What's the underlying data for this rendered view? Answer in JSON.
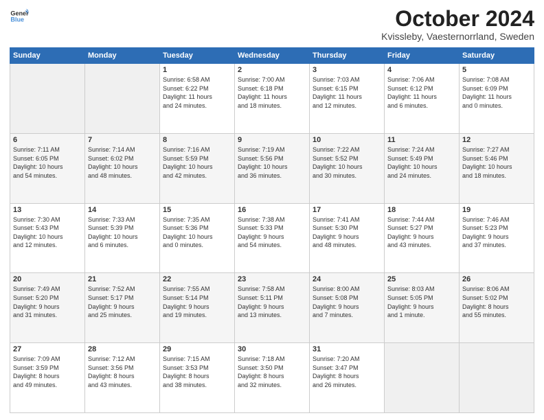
{
  "logo": {
    "line1": "General",
    "line2": "Blue"
  },
  "title": "October 2024",
  "subtitle": "Kvissleby, Vaesternorrland, Sweden",
  "weekdays": [
    "Sunday",
    "Monday",
    "Tuesday",
    "Wednesday",
    "Thursday",
    "Friday",
    "Saturday"
  ],
  "weeks": [
    [
      {
        "day": "",
        "info": ""
      },
      {
        "day": "",
        "info": ""
      },
      {
        "day": "1",
        "info": "Sunrise: 6:58 AM\nSunset: 6:22 PM\nDaylight: 11 hours\nand 24 minutes."
      },
      {
        "day": "2",
        "info": "Sunrise: 7:00 AM\nSunset: 6:18 PM\nDaylight: 11 hours\nand 18 minutes."
      },
      {
        "day": "3",
        "info": "Sunrise: 7:03 AM\nSunset: 6:15 PM\nDaylight: 11 hours\nand 12 minutes."
      },
      {
        "day": "4",
        "info": "Sunrise: 7:06 AM\nSunset: 6:12 PM\nDaylight: 11 hours\nand 6 minutes."
      },
      {
        "day": "5",
        "info": "Sunrise: 7:08 AM\nSunset: 6:09 PM\nDaylight: 11 hours\nand 0 minutes."
      }
    ],
    [
      {
        "day": "6",
        "info": "Sunrise: 7:11 AM\nSunset: 6:05 PM\nDaylight: 10 hours\nand 54 minutes."
      },
      {
        "day": "7",
        "info": "Sunrise: 7:14 AM\nSunset: 6:02 PM\nDaylight: 10 hours\nand 48 minutes."
      },
      {
        "day": "8",
        "info": "Sunrise: 7:16 AM\nSunset: 5:59 PM\nDaylight: 10 hours\nand 42 minutes."
      },
      {
        "day": "9",
        "info": "Sunrise: 7:19 AM\nSunset: 5:56 PM\nDaylight: 10 hours\nand 36 minutes."
      },
      {
        "day": "10",
        "info": "Sunrise: 7:22 AM\nSunset: 5:52 PM\nDaylight: 10 hours\nand 30 minutes."
      },
      {
        "day": "11",
        "info": "Sunrise: 7:24 AM\nSunset: 5:49 PM\nDaylight: 10 hours\nand 24 minutes."
      },
      {
        "day": "12",
        "info": "Sunrise: 7:27 AM\nSunset: 5:46 PM\nDaylight: 10 hours\nand 18 minutes."
      }
    ],
    [
      {
        "day": "13",
        "info": "Sunrise: 7:30 AM\nSunset: 5:43 PM\nDaylight: 10 hours\nand 12 minutes."
      },
      {
        "day": "14",
        "info": "Sunrise: 7:33 AM\nSunset: 5:39 PM\nDaylight: 10 hours\nand 6 minutes."
      },
      {
        "day": "15",
        "info": "Sunrise: 7:35 AM\nSunset: 5:36 PM\nDaylight: 10 hours\nand 0 minutes."
      },
      {
        "day": "16",
        "info": "Sunrise: 7:38 AM\nSunset: 5:33 PM\nDaylight: 9 hours\nand 54 minutes."
      },
      {
        "day": "17",
        "info": "Sunrise: 7:41 AM\nSunset: 5:30 PM\nDaylight: 9 hours\nand 48 minutes."
      },
      {
        "day": "18",
        "info": "Sunrise: 7:44 AM\nSunset: 5:27 PM\nDaylight: 9 hours\nand 43 minutes."
      },
      {
        "day": "19",
        "info": "Sunrise: 7:46 AM\nSunset: 5:23 PM\nDaylight: 9 hours\nand 37 minutes."
      }
    ],
    [
      {
        "day": "20",
        "info": "Sunrise: 7:49 AM\nSunset: 5:20 PM\nDaylight: 9 hours\nand 31 minutes."
      },
      {
        "day": "21",
        "info": "Sunrise: 7:52 AM\nSunset: 5:17 PM\nDaylight: 9 hours\nand 25 minutes."
      },
      {
        "day": "22",
        "info": "Sunrise: 7:55 AM\nSunset: 5:14 PM\nDaylight: 9 hours\nand 19 minutes."
      },
      {
        "day": "23",
        "info": "Sunrise: 7:58 AM\nSunset: 5:11 PM\nDaylight: 9 hours\nand 13 minutes."
      },
      {
        "day": "24",
        "info": "Sunrise: 8:00 AM\nSunset: 5:08 PM\nDaylight: 9 hours\nand 7 minutes."
      },
      {
        "day": "25",
        "info": "Sunrise: 8:03 AM\nSunset: 5:05 PM\nDaylight: 9 hours\nand 1 minute."
      },
      {
        "day": "26",
        "info": "Sunrise: 8:06 AM\nSunset: 5:02 PM\nDaylight: 8 hours\nand 55 minutes."
      }
    ],
    [
      {
        "day": "27",
        "info": "Sunrise: 7:09 AM\nSunset: 3:59 PM\nDaylight: 8 hours\nand 49 minutes."
      },
      {
        "day": "28",
        "info": "Sunrise: 7:12 AM\nSunset: 3:56 PM\nDaylight: 8 hours\nand 43 minutes."
      },
      {
        "day": "29",
        "info": "Sunrise: 7:15 AM\nSunset: 3:53 PM\nDaylight: 8 hours\nand 38 minutes."
      },
      {
        "day": "30",
        "info": "Sunrise: 7:18 AM\nSunset: 3:50 PM\nDaylight: 8 hours\nand 32 minutes."
      },
      {
        "day": "31",
        "info": "Sunrise: 7:20 AM\nSunset: 3:47 PM\nDaylight: 8 hours\nand 26 minutes."
      },
      {
        "day": "",
        "info": ""
      },
      {
        "day": "",
        "info": ""
      }
    ]
  ]
}
